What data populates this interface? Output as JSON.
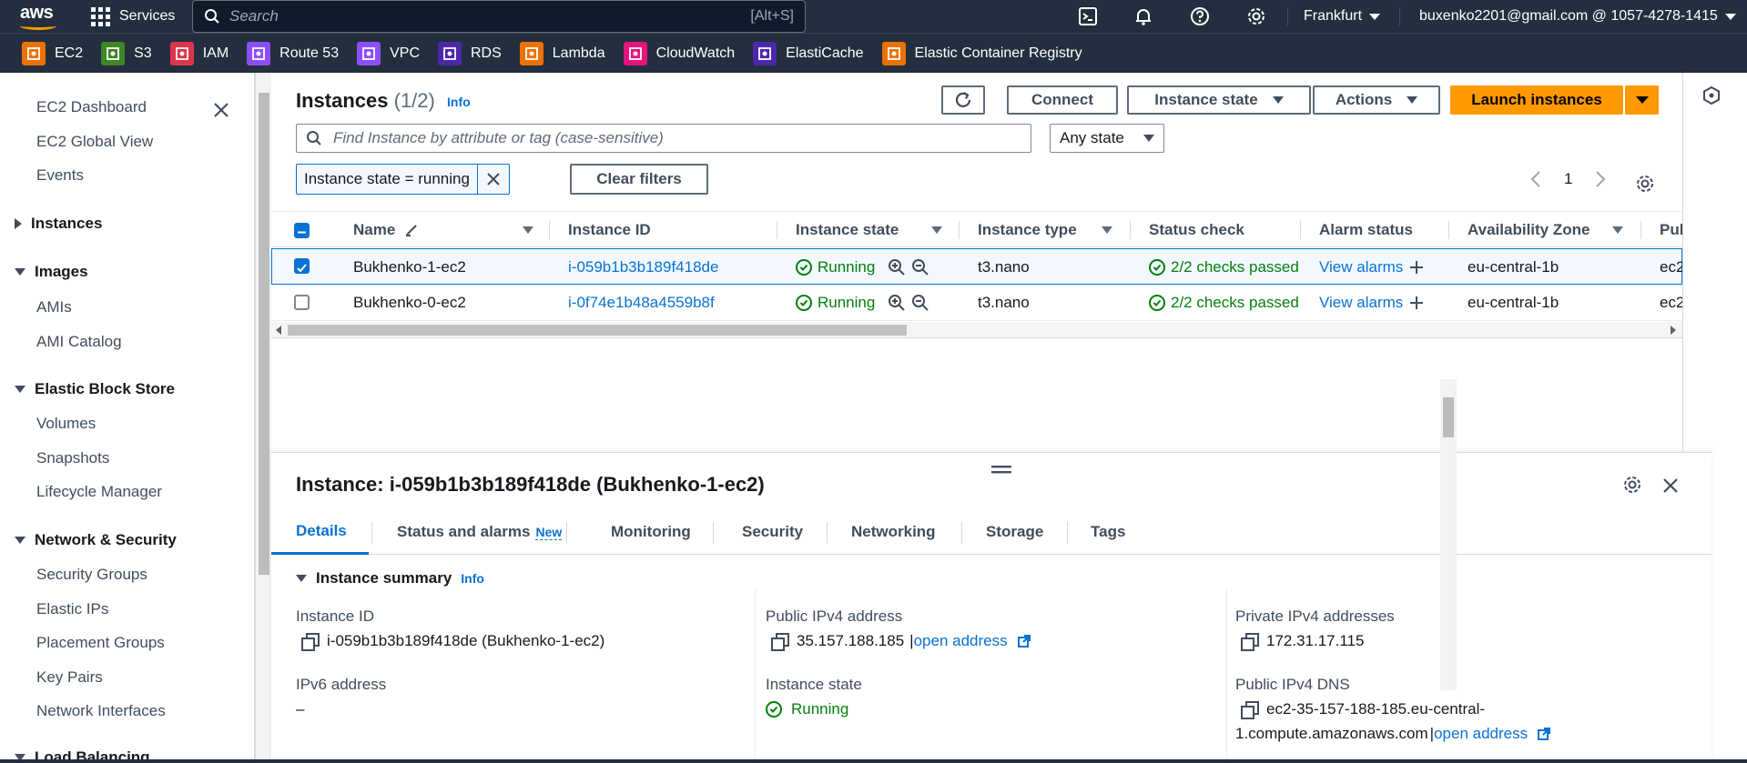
{
  "topnav": {
    "logo": "aws",
    "services": "Services",
    "search_placeholder": "Search",
    "search_shortcut": "[Alt+S]",
    "region": "Frankfurt",
    "account": "buxenko2201@gmail.com @ 1057-4278-1415",
    "icons": [
      "cloudshell-icon",
      "notifications-icon",
      "help-icon",
      "settings-icon"
    ]
  },
  "favorites": [
    {
      "label": "EC2",
      "color": "#ed7100",
      "icon": "ec2-icon"
    },
    {
      "label": "S3",
      "color": "#3f8624",
      "icon": "s3-icon"
    },
    {
      "label": "IAM",
      "color": "#dd344c",
      "icon": "iam-icon"
    },
    {
      "label": "Route 53",
      "color": "#8c4fff",
      "icon": "route53-icon"
    },
    {
      "label": "VPC",
      "color": "#8c4fff",
      "icon": "vpc-icon"
    },
    {
      "label": "RDS",
      "color": "#4d27aa",
      "icon": "rds-icon"
    },
    {
      "label": "Lambda",
      "color": "#ed7100",
      "icon": "lambda-icon"
    },
    {
      "label": "CloudWatch",
      "color": "#e7157b",
      "icon": "cloudwatch-icon"
    },
    {
      "label": "ElastiCache",
      "color": "#4d27aa",
      "icon": "elasticache-icon"
    },
    {
      "label": "Elastic Container Registry",
      "color": "#ed7100",
      "icon": "ecr-icon"
    }
  ],
  "sidebar": {
    "top_items": [
      "EC2 Dashboard",
      "EC2 Global View",
      "Events"
    ],
    "sections": [
      {
        "title": "Instances",
        "expanded": false,
        "items": []
      },
      {
        "title": "Images",
        "expanded": true,
        "items": [
          "AMIs",
          "AMI Catalog"
        ]
      },
      {
        "title": "Elastic Block Store",
        "expanded": true,
        "items": [
          "Volumes",
          "Snapshots",
          "Lifecycle Manager"
        ]
      },
      {
        "title": "Network & Security",
        "expanded": true,
        "items": [
          "Security Groups",
          "Elastic IPs",
          "Placement Groups",
          "Key Pairs",
          "Network Interfaces"
        ]
      },
      {
        "title": "Load Balancing",
        "expanded": true,
        "items": []
      }
    ]
  },
  "instances": {
    "title": "Instances",
    "count": "(1/2)",
    "info": "Info",
    "buttons": {
      "connect": "Connect",
      "instance_state": "Instance state",
      "actions": "Actions",
      "launch": "Launch instances",
      "clear_filters": "Clear filters"
    },
    "filter_placeholder": "Find Instance by attribute or tag (case-sensitive)",
    "state_select": "Any state",
    "filter_token": "Instance state = running",
    "page": "1",
    "columns": [
      "Name",
      "Instance ID",
      "Instance state",
      "Instance type",
      "Status check",
      "Alarm status",
      "Availability Zone",
      "Pul"
    ],
    "rows": [
      {
        "selected": true,
        "name": "Bukhenko-1-ec2",
        "id": "i-059b1b3b189f418de",
        "state": "Running",
        "type": "t3.nano",
        "status": "2/2 checks passed",
        "alarm": "View alarms",
        "az": "eu-central-1b",
        "pub": "ec2"
      },
      {
        "selected": false,
        "name": "Bukhenko-0-ec2",
        "id": "i-0f74e1b48a4559b8f",
        "state": "Running",
        "type": "t3.nano",
        "status": "2/2 checks passed",
        "alarm": "View alarms",
        "az": "eu-central-1b",
        "pub": "ec2"
      }
    ]
  },
  "detail": {
    "title": "Instance: i-059b1b3b189f418de (Bukhenko-1-ec2)",
    "tabs": [
      "Details",
      "Status and alarms",
      "Monitoring",
      "Security",
      "Networking",
      "Storage",
      "Tags"
    ],
    "new_badge": "New",
    "summary": "Instance summary",
    "info": "Info",
    "fields": {
      "instance_id_label": "Instance ID",
      "instance_id_value": "i-059b1b3b189f418de (Bukhenko-1-ec2)",
      "public_ipv4_label": "Public IPv4 address",
      "public_ipv4_value": "35.157.188.185",
      "open_address": "open address",
      "private_ipv4_label": "Private IPv4 addresses",
      "private_ipv4_value": "172.31.17.115",
      "ipv6_label": "IPv6 address",
      "ipv6_value": "–",
      "state_label": "Instance state",
      "state_value": "Running",
      "dns_label": "Public IPv4 DNS",
      "dns_value_1": "ec2-35-157-188-185.eu-central-",
      "dns_value_2": "1.compute.amazonaws.com"
    }
  },
  "colors": {
    "accent": "#0972d3",
    "primary": "#ff9900",
    "success": "#037f0c",
    "nav": "#232f3e"
  }
}
